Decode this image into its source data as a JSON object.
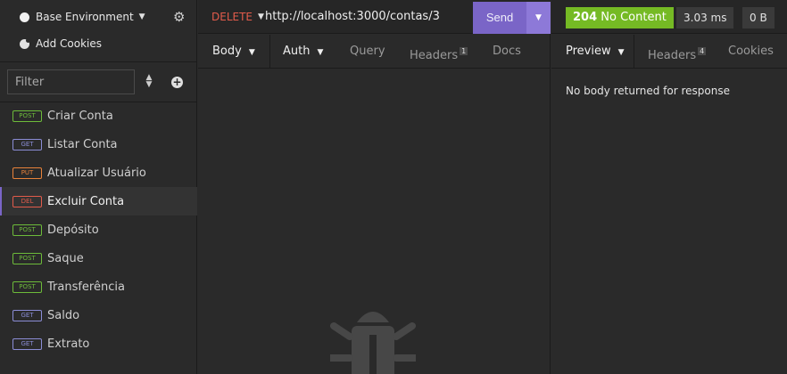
{
  "sidebar": {
    "environment": "Base Environment",
    "add_cookies": "Add Cookies",
    "filter_placeholder": "Filter",
    "requests": [
      {
        "method": "POST",
        "name": "Criar Conta",
        "color": "#6dbb3a"
      },
      {
        "method": "GET",
        "name": "Listar Conta",
        "color": "#8b8dd6"
      },
      {
        "method": "PUT",
        "name": "Atualizar Usuário",
        "color": "#e8823a"
      },
      {
        "method": "DEL",
        "name": "Excluir Conta",
        "color": "#e25b4b",
        "active": true
      },
      {
        "method": "POST",
        "name": "Depósito",
        "color": "#6dbb3a"
      },
      {
        "method": "POST",
        "name": "Saque",
        "color": "#6dbb3a"
      },
      {
        "method": "POST",
        "name": "Transferência",
        "color": "#6dbb3a"
      },
      {
        "method": "GET",
        "name": "Saldo",
        "color": "#8b8dd6"
      },
      {
        "method": "GET",
        "name": "Extrato",
        "color": "#8b8dd6"
      }
    ]
  },
  "request": {
    "method": "DELETE",
    "url": "http://localhost:3000/contas/3",
    "send_label": "Send",
    "tabs": {
      "body": "Body",
      "auth": "Auth",
      "query": "Query",
      "headers": "Headers",
      "headers_count": "1",
      "docs": "Docs"
    }
  },
  "response": {
    "status_code": "204",
    "status_text": "No Content",
    "timing": "3.03 ms",
    "size": "0 B",
    "tabs": {
      "preview": "Preview",
      "headers": "Headers",
      "headers_count": "4",
      "cookies": "Cookies"
    },
    "empty_message": "No body returned for response"
  },
  "colors": {
    "accent": "#7a65c7",
    "status_ok": "#75ba24",
    "delete": "#e25b4b"
  }
}
